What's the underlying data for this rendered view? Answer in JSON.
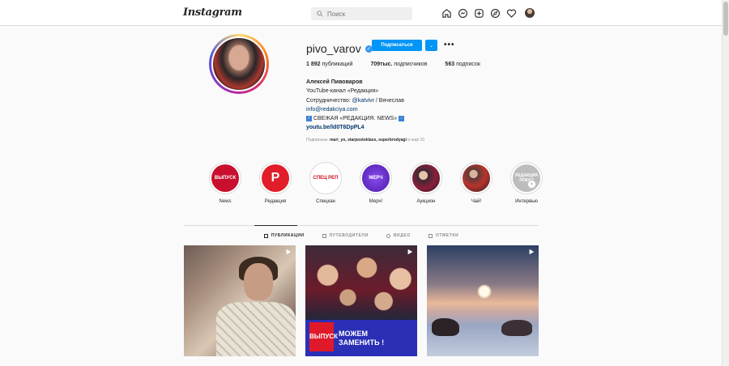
{
  "header": {
    "logo": "Instagram",
    "search_placeholder": "Поиск"
  },
  "profile": {
    "username": "pivo_varov",
    "follow_label": "Подписаться",
    "dropdown_label": "⌄",
    "more_label": "•••",
    "stats": {
      "posts_count": "1 892",
      "posts_label": "публикаций",
      "followers_count": "709тыс.",
      "followers_label": "подписчиков",
      "following_count": "563",
      "following_label": "подписок"
    },
    "bio": {
      "full_name": "Алексей Пивоваров",
      "line1": "YouTube-канал «Редакция»",
      "line2_prefix": "Сотрудничество: ",
      "line2_mention": "@katvivr",
      "line2_suffix": " / Вячеслав",
      "line3": "info@redakciya.com",
      "line4_icon_left": "i",
      "line4_text": "СВЕЖАЯ «РЕДАКЦИЯ. NEWS»",
      "line4_icon_right": "↓",
      "link": "youtu.be/ld0T6DpPL4"
    },
    "followed_by_prefix": "Подписаны: ",
    "followed_by_names": "mari_yo, starpostoklass, superbrodyagi",
    "followed_by_suffix": " и ещё 10"
  },
  "highlights": [
    {
      "label": "News",
      "inner_text": "ВЫПУСК",
      "color": "#c8102e"
    },
    {
      "label": "Редакция",
      "inner_text": "P",
      "color": "#e11d2a"
    },
    {
      "label": "Спецкан",
      "inner_text": "СПЕЦ РЕП",
      "color": "#ffffff"
    },
    {
      "label": "Мерч!",
      "inner_text": "МЕРЧ",
      "color": "#6a2bd8"
    },
    {
      "label": "Аукцион",
      "inner_text": "",
      "color": "#3b2a33"
    },
    {
      "label": "Чай!",
      "inner_text": "",
      "color": "#5a3b3a"
    },
    {
      "label": "Интервью",
      "inner_text": "РЕДАКЦИЯ ПОКАЗ",
      "color": "#bdbdbd"
    }
  ],
  "highlights_next": "›",
  "tabs": [
    {
      "label": "ПУБЛИКАЦИИ",
      "active": true
    },
    {
      "label": "ПУТЕВОДИТЕЛИ",
      "active": false
    },
    {
      "label": "ВИДЕО",
      "active": false
    },
    {
      "label": "ОТМЕТКИ",
      "active": false
    }
  ],
  "posts": {
    "post2_badge": "ВЫПУСК",
    "post2_text_line1": "МОЖЕМ",
    "post2_text_line2": "ЗАМЕНИТЬ !"
  },
  "colors": {
    "accent": "#0095f6",
    "link": "#00376b"
  }
}
